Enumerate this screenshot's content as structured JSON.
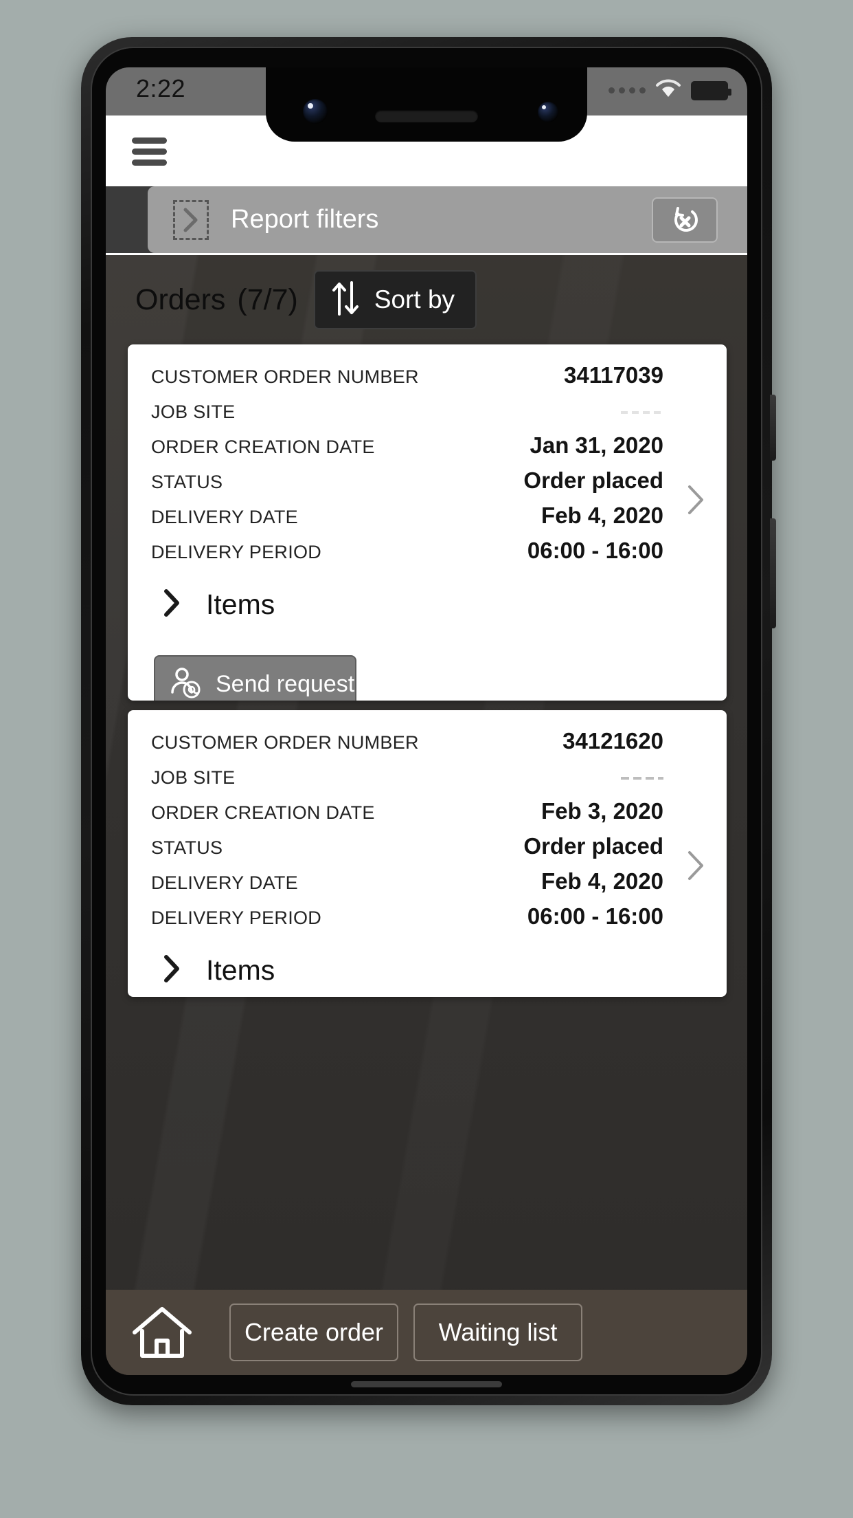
{
  "status_bar": {
    "time": "2:22",
    "signal_icon": "signal-dots-icon",
    "wifi_icon": "wifi-icon",
    "battery_icon": "battery-full-icon"
  },
  "app_bar": {
    "menu_icon": "hamburger-menu-icon"
  },
  "filters": {
    "title": "Report filters",
    "expand_icon": "chevron-right-icon",
    "reset_icon": "reset-filters-icon"
  },
  "orders_header": {
    "title": "Orders",
    "count": "(7/7)",
    "sort_label": "Sort by",
    "sort_icon": "sort-arrows-icon"
  },
  "labels": {
    "customer_order_number": "CUSTOMER ORDER NUMBER",
    "job_site": "JOB SITE",
    "order_creation_date": "ORDER CREATION DATE",
    "status": "STATUS",
    "delivery_date": "DELIVERY DATE",
    "delivery_period": "DELIVERY PERIOD",
    "items": "Items",
    "send_request": "Send request"
  },
  "orders": [
    {
      "customer_order_number": "34117039",
      "job_site": "",
      "order_creation_date": "Jan 31, 2020",
      "status": "Order placed",
      "delivery_date": "Feb 4, 2020",
      "delivery_period": "06:00 - 16:00",
      "items_label": "Items",
      "send_request_label": "Send request",
      "detail_icon": "chevron-right-icon",
      "items_icon": "chevron-right-icon",
      "send_request_icon": "person-at-icon"
    },
    {
      "customer_order_number": "34121620",
      "job_site": "",
      "order_creation_date": "Feb 3, 2020",
      "status": "Order placed",
      "delivery_date": "Feb 4, 2020",
      "delivery_period": "06:00 - 16:00",
      "items_label": "Items",
      "detail_icon": "chevron-right-icon",
      "items_icon": "chevron-right-icon"
    }
  ],
  "bottom_nav": {
    "home_icon": "home-icon",
    "create_order": "Create order",
    "waiting_list": "Waiting list"
  },
  "colors": {
    "card_background": "#ffffff",
    "filters_pill": "#9e9e9e",
    "sort_button": "#222222",
    "send_request_button": "#7d7d7d",
    "bottom_bar": "#4c443c",
    "status_bar": "#6e6e6e",
    "backdrop": "#a3adab"
  }
}
